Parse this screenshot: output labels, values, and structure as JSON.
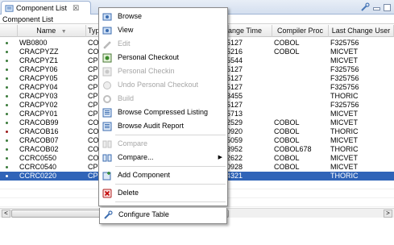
{
  "tab": {
    "title": "Component List",
    "close_glyph": "☒"
  },
  "subtitle": "Component List",
  "columns": [
    "",
    "Name",
    "Typ",
    "",
    "hange Time",
    "Compiler Proc",
    "Last Change User"
  ],
  "rows": [
    {
      "name": "WB0800",
      "type": "COB",
      "time": "5127",
      "proc": "COBOL",
      "user": "F325756",
      "status": "green"
    },
    {
      "name": "CRACPYZZ",
      "type": "COB",
      "time": "5216",
      "proc": "COBOL",
      "user": "MICVET",
      "status": "green"
    },
    {
      "name": "CRACPYZ1",
      "type": "CPY",
      "time": "5544",
      "proc": "",
      "user": "MICVET",
      "status": "green"
    },
    {
      "name": "CRACPY06",
      "type": "CPY",
      "time": "5127",
      "proc": "",
      "user": "F325756",
      "status": "green"
    },
    {
      "name": "CRACPY05",
      "type": "CPY",
      "time": "5127",
      "proc": "",
      "user": "F325756",
      "status": "green"
    },
    {
      "name": "CRACPY04",
      "type": "CPY",
      "time": "5127",
      "proc": "",
      "user": "F325756",
      "status": "green"
    },
    {
      "name": "CRACPY03",
      "type": "CPY",
      "time": "3455",
      "proc": "",
      "user": "THORIC",
      "status": "green"
    },
    {
      "name": "CRACPY02",
      "type": "CPY",
      "time": "5127",
      "proc": "",
      "user": "F325756",
      "status": "green"
    },
    {
      "name": "CRACPY01",
      "type": "CPY",
      "time": "5713",
      "proc": "",
      "user": "MICVET",
      "status": "green"
    },
    {
      "name": "CRACOB99",
      "type": "COB",
      "time": "2529",
      "proc": "COBOL",
      "user": "MICVET",
      "status": "green"
    },
    {
      "name": "CRACOB16",
      "type": "COB",
      "time": "0920",
      "proc": "COBOL",
      "user": "THORIC",
      "status": "red"
    },
    {
      "name": "CRACOB07",
      "type": "COB",
      "time": "5059",
      "proc": "COBOL",
      "user": "MICVET",
      "status": "green"
    },
    {
      "name": "CRACOB02",
      "type": "COB",
      "time": "3952",
      "proc": "COBOL678",
      "user": "THORIC",
      "status": "green"
    },
    {
      "name": "CCRC0550",
      "type": "COB",
      "time": "2622",
      "proc": "COBOL",
      "user": "MICVET",
      "status": "green"
    },
    {
      "name": "CCRC0540",
      "type": "CPY",
      "time": "0928",
      "proc": "COBOL",
      "user": "MICVET",
      "status": "green"
    },
    {
      "name": "CCRC0220",
      "type": "CPY",
      "time": "4321",
      "proc": "",
      "user": "THORIC",
      "status": "green",
      "selected": true
    }
  ],
  "menu": {
    "browse": "Browse",
    "view": "View",
    "edit": "Edit",
    "personal_checkout": "Personal Checkout",
    "personal_checkin": "Personal Checkin",
    "undo_personal_checkout": "Undo Personal Checkout",
    "build": "Build",
    "browse_compressed": "Browse Compressed Listing",
    "browse_audit": "Browse Audit Report",
    "compare": "Compare",
    "compare_more": "Compare...",
    "add_component": "Add Component",
    "delete": "Delete",
    "configure_table": "Configure Table"
  },
  "scroll": {
    "left": "<",
    "right": ">"
  },
  "colors": {
    "selection": "#3064b8",
    "status_ok": "#3a7a3a",
    "status_error": "#9b1b1b"
  }
}
